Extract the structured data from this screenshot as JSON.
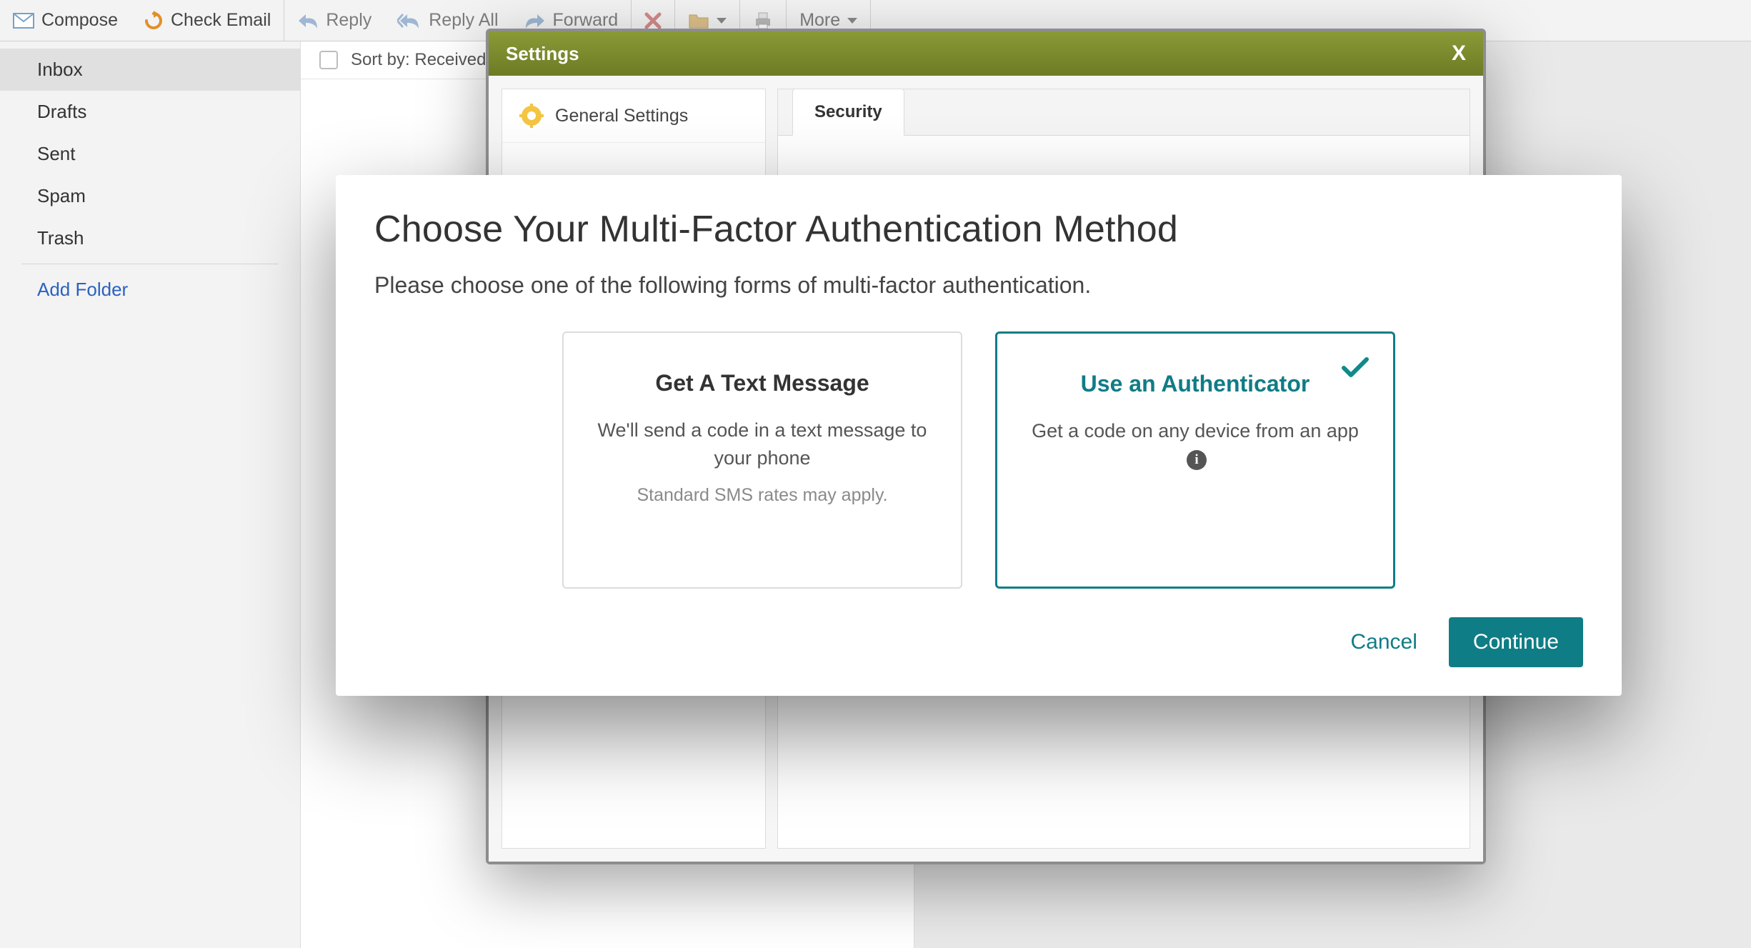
{
  "toolbar": {
    "compose": "Compose",
    "check": "Check Email",
    "reply": "Reply",
    "reply_all": "Reply All",
    "forward": "Forward",
    "more": "More"
  },
  "sidebar": {
    "folders": [
      "Inbox",
      "Drafts",
      "Sent",
      "Spam",
      "Trash"
    ],
    "add_folder": "Add Folder"
  },
  "list": {
    "sort_label": "Sort by: Received"
  },
  "settings_dialog": {
    "title": "Settings",
    "nav_general": "General Settings",
    "tab_security": "Security"
  },
  "mfa_modal": {
    "title": "Choose Your Multi-Factor Authentication Method",
    "subtitle": "Please choose one of the following forms of multi-factor authentication.",
    "option_sms_title": "Get A Text Message",
    "option_sms_desc": "We'll send a code in a text message to your phone",
    "option_sms_fine": "Standard SMS rates may apply.",
    "option_auth_title": "Use an Authenticator",
    "option_auth_desc": "Get a code on any device from an app",
    "cancel": "Cancel",
    "continue": "Continue"
  }
}
